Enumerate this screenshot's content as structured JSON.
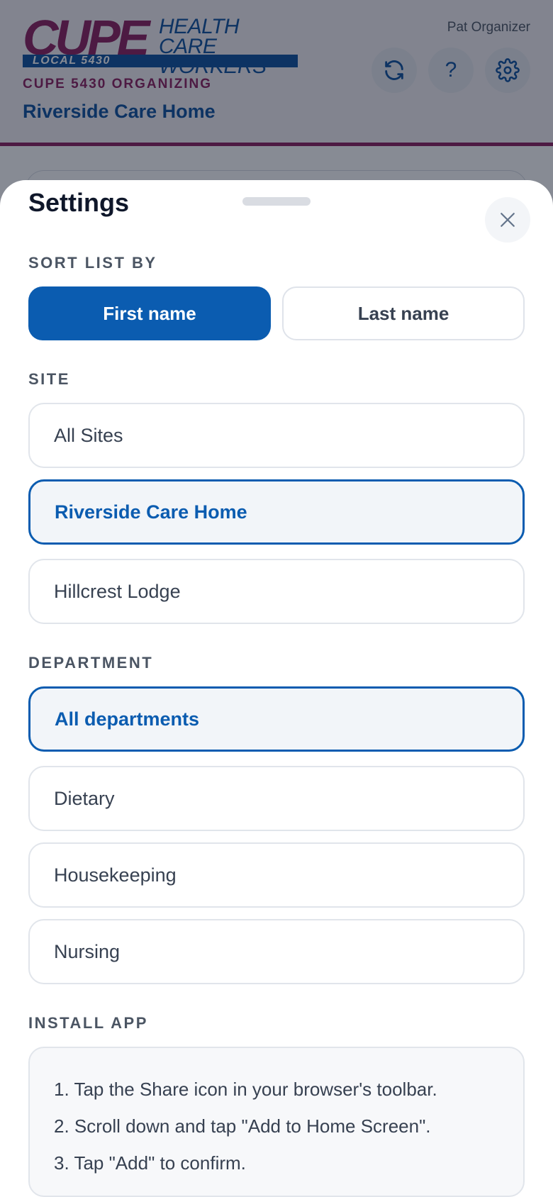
{
  "header": {
    "logo": {
      "primary": "CUPE",
      "secondary": "HEALTH CARE WORKERS",
      "local": "LOCAL 5430"
    },
    "org_label": "CUPE 5430 ORGANIZING",
    "site_title": "Riverside Care Home",
    "user_name": "Pat Organizer",
    "buttons": {
      "refresh_icon": "refresh-icon",
      "help_label": "?",
      "settings_icon": "gear-icon"
    }
  },
  "settings": {
    "title": "Settings",
    "close_icon": "close-icon",
    "sort": {
      "label": "SORT LIST BY",
      "options": [
        "First name",
        "Last name"
      ],
      "selected": "First name"
    },
    "site": {
      "label": "SITE",
      "options": [
        "All Sites",
        "Riverside Care Home",
        "Hillcrest Lodge"
      ],
      "selected": "Riverside Care Home"
    },
    "department": {
      "label": "DEPARTMENT",
      "options": [
        "All departments",
        "Dietary",
        "Housekeeping",
        "Nursing"
      ],
      "selected": "All departments"
    },
    "install": {
      "label": "INSTALL APP",
      "steps": [
        "1. Tap the Share icon in your browser's toolbar.",
        "2. Scroll down and tap \"Add to Home Screen\".",
        "3. Tap \"Add\" to confirm."
      ]
    }
  },
  "colors": {
    "brand_blue": "#0b5cb0",
    "brand_magenta": "#8a1d5c",
    "overlay": "rgba(15,23,42,0.5)"
  }
}
